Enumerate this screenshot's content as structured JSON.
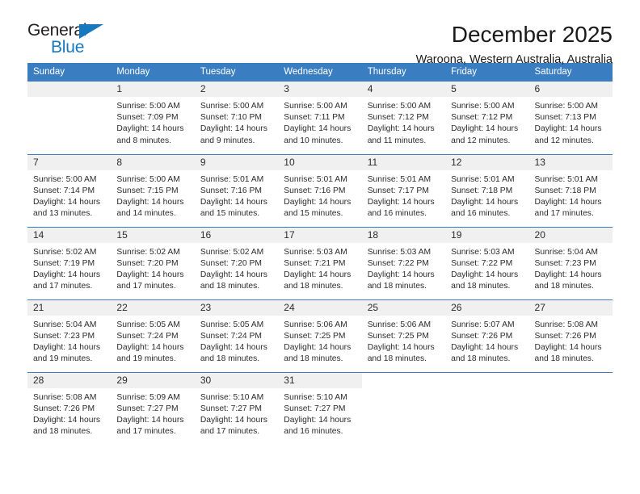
{
  "brand": {
    "name_part1": "General",
    "name_part2": "Blue",
    "accent_color": "#1878be"
  },
  "header": {
    "title": "December 2025",
    "subtitle": "Waroona, Western Australia, Australia"
  },
  "calendar": {
    "header_color": "#3a7dc0",
    "weekday_headers": [
      "Sunday",
      "Monday",
      "Tuesday",
      "Wednesday",
      "Thursday",
      "Friday",
      "Saturday"
    ],
    "weeks": [
      [
        {
          "day": "",
          "sunrise": "",
          "sunset": "",
          "daylight_line1": "",
          "daylight_line2": "",
          "blank": true
        },
        {
          "day": "1",
          "sunrise": "Sunrise: 5:00 AM",
          "sunset": "Sunset: 7:09 PM",
          "daylight_line1": "Daylight: 14 hours",
          "daylight_line2": "and 8 minutes."
        },
        {
          "day": "2",
          "sunrise": "Sunrise: 5:00 AM",
          "sunset": "Sunset: 7:10 PM",
          "daylight_line1": "Daylight: 14 hours",
          "daylight_line2": "and 9 minutes."
        },
        {
          "day": "3",
          "sunrise": "Sunrise: 5:00 AM",
          "sunset": "Sunset: 7:11 PM",
          "daylight_line1": "Daylight: 14 hours",
          "daylight_line2": "and 10 minutes."
        },
        {
          "day": "4",
          "sunrise": "Sunrise: 5:00 AM",
          "sunset": "Sunset: 7:12 PM",
          "daylight_line1": "Daylight: 14 hours",
          "daylight_line2": "and 11 minutes."
        },
        {
          "day": "5",
          "sunrise": "Sunrise: 5:00 AM",
          "sunset": "Sunset: 7:12 PM",
          "daylight_line1": "Daylight: 14 hours",
          "daylight_line2": "and 12 minutes."
        },
        {
          "day": "6",
          "sunrise": "Sunrise: 5:00 AM",
          "sunset": "Sunset: 7:13 PM",
          "daylight_line1": "Daylight: 14 hours",
          "daylight_line2": "and 12 minutes."
        }
      ],
      [
        {
          "day": "7",
          "sunrise": "Sunrise: 5:00 AM",
          "sunset": "Sunset: 7:14 PM",
          "daylight_line1": "Daylight: 14 hours",
          "daylight_line2": "and 13 minutes."
        },
        {
          "day": "8",
          "sunrise": "Sunrise: 5:00 AM",
          "sunset": "Sunset: 7:15 PM",
          "daylight_line1": "Daylight: 14 hours",
          "daylight_line2": "and 14 minutes."
        },
        {
          "day": "9",
          "sunrise": "Sunrise: 5:01 AM",
          "sunset": "Sunset: 7:16 PM",
          "daylight_line1": "Daylight: 14 hours",
          "daylight_line2": "and 15 minutes."
        },
        {
          "day": "10",
          "sunrise": "Sunrise: 5:01 AM",
          "sunset": "Sunset: 7:16 PM",
          "daylight_line1": "Daylight: 14 hours",
          "daylight_line2": "and 15 minutes."
        },
        {
          "day": "11",
          "sunrise": "Sunrise: 5:01 AM",
          "sunset": "Sunset: 7:17 PM",
          "daylight_line1": "Daylight: 14 hours",
          "daylight_line2": "and 16 minutes."
        },
        {
          "day": "12",
          "sunrise": "Sunrise: 5:01 AM",
          "sunset": "Sunset: 7:18 PM",
          "daylight_line1": "Daylight: 14 hours",
          "daylight_line2": "and 16 minutes."
        },
        {
          "day": "13",
          "sunrise": "Sunrise: 5:01 AM",
          "sunset": "Sunset: 7:18 PM",
          "daylight_line1": "Daylight: 14 hours",
          "daylight_line2": "and 17 minutes."
        }
      ],
      [
        {
          "day": "14",
          "sunrise": "Sunrise: 5:02 AM",
          "sunset": "Sunset: 7:19 PM",
          "daylight_line1": "Daylight: 14 hours",
          "daylight_line2": "and 17 minutes."
        },
        {
          "day": "15",
          "sunrise": "Sunrise: 5:02 AM",
          "sunset": "Sunset: 7:20 PM",
          "daylight_line1": "Daylight: 14 hours",
          "daylight_line2": "and 17 minutes."
        },
        {
          "day": "16",
          "sunrise": "Sunrise: 5:02 AM",
          "sunset": "Sunset: 7:20 PM",
          "daylight_line1": "Daylight: 14 hours",
          "daylight_line2": "and 18 minutes."
        },
        {
          "day": "17",
          "sunrise": "Sunrise: 5:03 AM",
          "sunset": "Sunset: 7:21 PM",
          "daylight_line1": "Daylight: 14 hours",
          "daylight_line2": "and 18 minutes."
        },
        {
          "day": "18",
          "sunrise": "Sunrise: 5:03 AM",
          "sunset": "Sunset: 7:22 PM",
          "daylight_line1": "Daylight: 14 hours",
          "daylight_line2": "and 18 minutes."
        },
        {
          "day": "19",
          "sunrise": "Sunrise: 5:03 AM",
          "sunset": "Sunset: 7:22 PM",
          "daylight_line1": "Daylight: 14 hours",
          "daylight_line2": "and 18 minutes."
        },
        {
          "day": "20",
          "sunrise": "Sunrise: 5:04 AM",
          "sunset": "Sunset: 7:23 PM",
          "daylight_line1": "Daylight: 14 hours",
          "daylight_line2": "and 18 minutes."
        }
      ],
      [
        {
          "day": "21",
          "sunrise": "Sunrise: 5:04 AM",
          "sunset": "Sunset: 7:23 PM",
          "daylight_line1": "Daylight: 14 hours",
          "daylight_line2": "and 19 minutes."
        },
        {
          "day": "22",
          "sunrise": "Sunrise: 5:05 AM",
          "sunset": "Sunset: 7:24 PM",
          "daylight_line1": "Daylight: 14 hours",
          "daylight_line2": "and 19 minutes."
        },
        {
          "day": "23",
          "sunrise": "Sunrise: 5:05 AM",
          "sunset": "Sunset: 7:24 PM",
          "daylight_line1": "Daylight: 14 hours",
          "daylight_line2": "and 18 minutes."
        },
        {
          "day": "24",
          "sunrise": "Sunrise: 5:06 AM",
          "sunset": "Sunset: 7:25 PM",
          "daylight_line1": "Daylight: 14 hours",
          "daylight_line2": "and 18 minutes."
        },
        {
          "day": "25",
          "sunrise": "Sunrise: 5:06 AM",
          "sunset": "Sunset: 7:25 PM",
          "daylight_line1": "Daylight: 14 hours",
          "daylight_line2": "and 18 minutes."
        },
        {
          "day": "26",
          "sunrise": "Sunrise: 5:07 AM",
          "sunset": "Sunset: 7:26 PM",
          "daylight_line1": "Daylight: 14 hours",
          "daylight_line2": "and 18 minutes."
        },
        {
          "day": "27",
          "sunrise": "Sunrise: 5:08 AM",
          "sunset": "Sunset: 7:26 PM",
          "daylight_line1": "Daylight: 14 hours",
          "daylight_line2": "and 18 minutes."
        }
      ],
      [
        {
          "day": "28",
          "sunrise": "Sunrise: 5:08 AM",
          "sunset": "Sunset: 7:26 PM",
          "daylight_line1": "Daylight: 14 hours",
          "daylight_line2": "and 18 minutes."
        },
        {
          "day": "29",
          "sunrise": "Sunrise: 5:09 AM",
          "sunset": "Sunset: 7:27 PM",
          "daylight_line1": "Daylight: 14 hours",
          "daylight_line2": "and 17 minutes."
        },
        {
          "day": "30",
          "sunrise": "Sunrise: 5:10 AM",
          "sunset": "Sunset: 7:27 PM",
          "daylight_line1": "Daylight: 14 hours",
          "daylight_line2": "and 17 minutes."
        },
        {
          "day": "31",
          "sunrise": "Sunrise: 5:10 AM",
          "sunset": "Sunset: 7:27 PM",
          "daylight_line1": "Daylight: 14 hours",
          "daylight_line2": "and 16 minutes."
        },
        {
          "day": "",
          "sunrise": "",
          "sunset": "",
          "daylight_line1": "",
          "daylight_line2": "",
          "blank": true,
          "nofill": true
        },
        {
          "day": "",
          "sunrise": "",
          "sunset": "",
          "daylight_line1": "",
          "daylight_line2": "",
          "blank": true,
          "nofill": true
        },
        {
          "day": "",
          "sunrise": "",
          "sunset": "",
          "daylight_line1": "",
          "daylight_line2": "",
          "blank": true,
          "nofill": true
        }
      ]
    ]
  }
}
